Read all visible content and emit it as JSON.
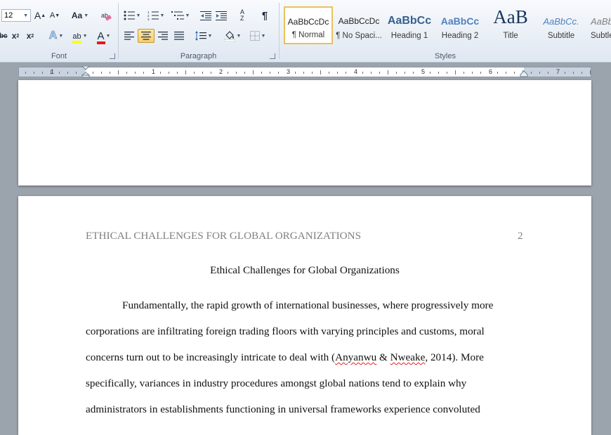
{
  "ribbon": {
    "font_group": {
      "label": "Font",
      "font_size": "12",
      "grow_font_icon": "A",
      "shrink_font_icon": "A",
      "change_case_icon": "Aa",
      "strikethrough_icon": "abc",
      "subscript_icon": "x",
      "superscript_icon": "x",
      "text_effects_icon": "A",
      "highlight_icon": "ab",
      "font_color_icon": "A",
      "highlight_color": "#ffff00",
      "font_color_value": "#e01b1b"
    },
    "paragraph_group": {
      "label": "Paragraph",
      "sort_icon": "A Z",
      "pilcrow_icon": "¶"
    },
    "styles_group": {
      "label": "Styles",
      "items": [
        {
          "sample": "AaBbCcDc",
          "name": "¶ Normal"
        },
        {
          "sample": "AaBbCcDc",
          "name": "¶ No Spaci..."
        },
        {
          "sample": "AaBbCc",
          "name": "Heading 1"
        },
        {
          "sample": "AaBbCc",
          "name": "Heading 2"
        },
        {
          "sample": "AaB",
          "name": "Title"
        },
        {
          "sample": "AaBbCc.",
          "name": "Subtitle"
        },
        {
          "sample": "AaBbCc",
          "name": "Subtle"
        }
      ]
    }
  },
  "ruler": {
    "numbers": [
      "1",
      "1",
      "2",
      "3",
      "4",
      "5",
      "6",
      "7"
    ]
  },
  "page2": {
    "running_head": "ETHICAL CHALLENGES FOR GLOBAL ORGANIZATIONS",
    "page_number": "2",
    "title": "Ethical Challenges for Global Organizations",
    "lines": [
      "Fundamentally, the rapid growth of international businesses, where progressively more",
      "corporations are infiltrating foreign trading floors with varying principles and customs, moral",
      "specifically, variances in industry procedures amongst global nations tend to explain why",
      "administrators in establishments functioning in universal frameworks experience convoluted"
    ],
    "line3": {
      "before": "concerns turn out to be increasingly intricate to deal with (",
      "author1": "Anyanwu",
      "amp": " & ",
      "author2": "Nweake",
      "after": ", 2014). More"
    }
  },
  "colors": {
    "accent": "#f8cf6a",
    "heading_blue": "#365f91",
    "ribbon_bg": "#dfe7f1"
  }
}
